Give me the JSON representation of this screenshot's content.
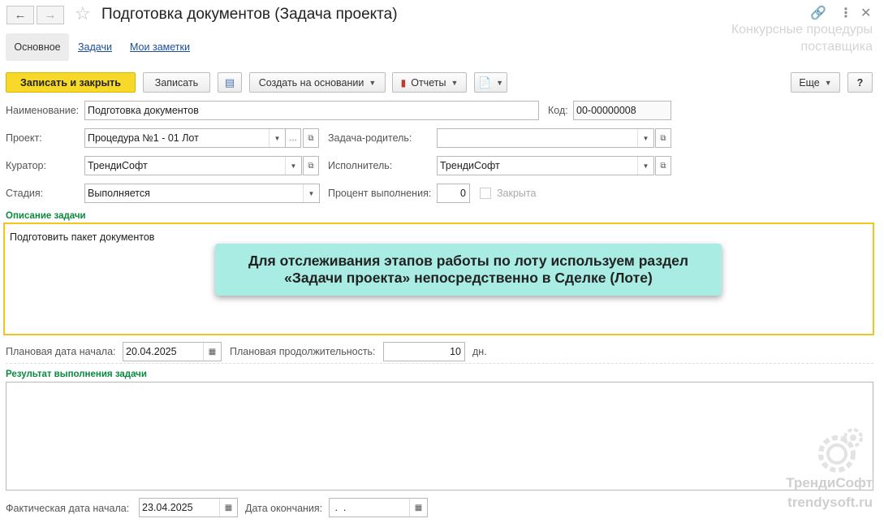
{
  "window": {
    "title": "Подготовка документов (Задача проекта)",
    "watermark_line1": "Конкурсные процедуры",
    "watermark_line2": "поставщика"
  },
  "tabs": {
    "main": "Основное",
    "tasks": "Задачи",
    "notes": "Мои заметки"
  },
  "toolbar": {
    "save_close": "Записать и закрыть",
    "save": "Записать",
    "create_based": "Создать на основании",
    "reports": "Отчеты",
    "more": "Еще",
    "help": "?"
  },
  "form": {
    "name_label": "Наименование:",
    "name_value": "Подготовка документов",
    "code_label": "Код:",
    "code_value": "00-00000008",
    "project_label": "Проект:",
    "project_value": "Процедура №1 - 01 Лот",
    "parent_label": "Задача-родитель:",
    "parent_value": "",
    "curator_label": "Куратор:",
    "curator_value": "ТрендиСофт",
    "executor_label": "Исполнитель:",
    "executor_value": "ТрендиСофт",
    "stage_label": "Стадия:",
    "stage_value": "Выполняется",
    "percent_label": "Процент выполнения:",
    "percent_value": "0",
    "closed_label": "Закрыта",
    "description_section": "Описание задачи",
    "description_text": "Подготовить пакет документов",
    "planned_start_label": "Плановая дата начала:",
    "planned_start_value": "20.04.2025",
    "planned_duration_label": "Плановая продолжительность:",
    "planned_duration_value": "10",
    "days_unit": "дн.",
    "result_section": "Результат выполнения задачи",
    "result_text": "",
    "actual_start_label": "Фактическая дата начала:",
    "actual_start_value": "23.04.2025",
    "end_label": "Дата окончания:",
    "end_value": " .  ."
  },
  "callout": {
    "line1": "Для отслеживания этапов работы по лоту используем раздел",
    "line2": "«Задачи проекта» непосредственно в Сделке (Лоте)"
  },
  "brand": {
    "name": "ТрендиСофт",
    "site": "trendysoft.ru"
  }
}
